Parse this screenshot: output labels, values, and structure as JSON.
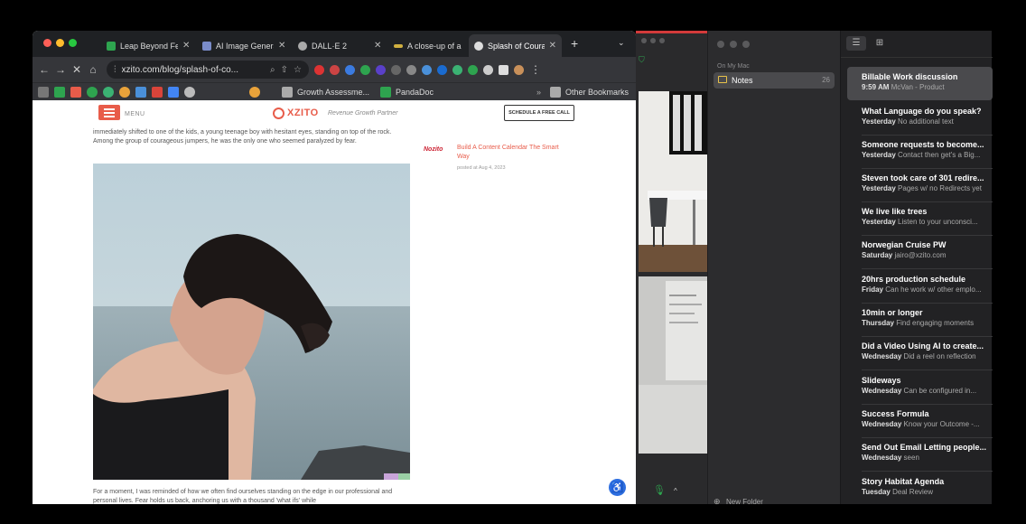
{
  "browser": {
    "tabs": [
      {
        "label": "Leap Beyond Fe",
        "fav": "#2ea44f"
      },
      {
        "label": "AI Image Genera",
        "fav": "#7a8cc9"
      },
      {
        "label": "DALL·E 2",
        "fav": "#aaaaaa"
      },
      {
        "label": "A close-up of a",
        "fav": "#d0b040"
      },
      {
        "label": "Splash of Coura",
        "fav": "#dddddd"
      }
    ],
    "new_tab": "+",
    "url": "xzito.com/blog/splash-of-co...",
    "bookmarks": [
      "Growth Assessme...",
      "PandaDoc"
    ],
    "other_bookmarks": "Other Bookmarks"
  },
  "page": {
    "menu_label": "MENU",
    "logo": "XZITO",
    "logo_tag": "Revenue Growth Partner",
    "cta": "SCHEDULE A FREE CALL",
    "intro": "immediately shifted to one of the kids, a young teenage boy with hesitant eyes, standing on top of the rock. Among the group of courageous jumpers, he was the only one who seemed paralyzed by fear.",
    "outro": "For a moment, I was reminded of how we often find ourselves standing on the edge in our professional and personal lives. Fear holds us back, anchoring us with a thousand 'what ifs' while",
    "sidebar": {
      "thumb": "Nozito",
      "title": "Build A Content Calendar The Smart Way",
      "date": "posted at Aug 4, 2023"
    }
  },
  "notes_app": {
    "section": "On My Mac",
    "folder": "Notes",
    "folder_count": "26",
    "items": [
      {
        "title": "Billable Work discussion",
        "date": "9:59 AM",
        "preview": "McVan - Product"
      },
      {
        "title": "What Language do you speak?",
        "date": "Yesterday",
        "preview": "No additional text"
      },
      {
        "title": "Someone requests to become...",
        "date": "Yesterday",
        "preview": "Contact then get's a Big..."
      },
      {
        "title": "Steven took care of 301 redire...",
        "date": "Yesterday",
        "preview": "Pages w/ no Redirects yet"
      },
      {
        "title": "We live like trees",
        "date": "Yesterday",
        "preview": "Listen to your unconsci..."
      },
      {
        "title": "Norwegian Cruise PW",
        "date": "Saturday",
        "preview": "jairo@xzito.com"
      },
      {
        "title": "20hrs production schedule",
        "date": "Friday",
        "preview": "Can he work w/ other emplo..."
      },
      {
        "title": "10min or longer",
        "date": "Thursday",
        "preview": "Find engaging moments"
      },
      {
        "title": "Did a Video Using AI to create...",
        "date": "Wednesday",
        "preview": "Did a reel on reflection"
      },
      {
        "title": "Slideways",
        "date": "Wednesday",
        "preview": "Can be configured in..."
      },
      {
        "title": "Success Formula",
        "date": "Wednesday",
        "preview": "Know your Outcome -..."
      },
      {
        "title": "Send Out Email Letting people...",
        "date": "Wednesday",
        "preview": "seen"
      },
      {
        "title": "Story Habitat Agenda",
        "date": "Tuesday",
        "preview": "Deal Review"
      }
    ],
    "new_folder": "New Folder"
  },
  "colors": {
    "accent": "#e85c4a",
    "link": "#2d6ee0"
  }
}
